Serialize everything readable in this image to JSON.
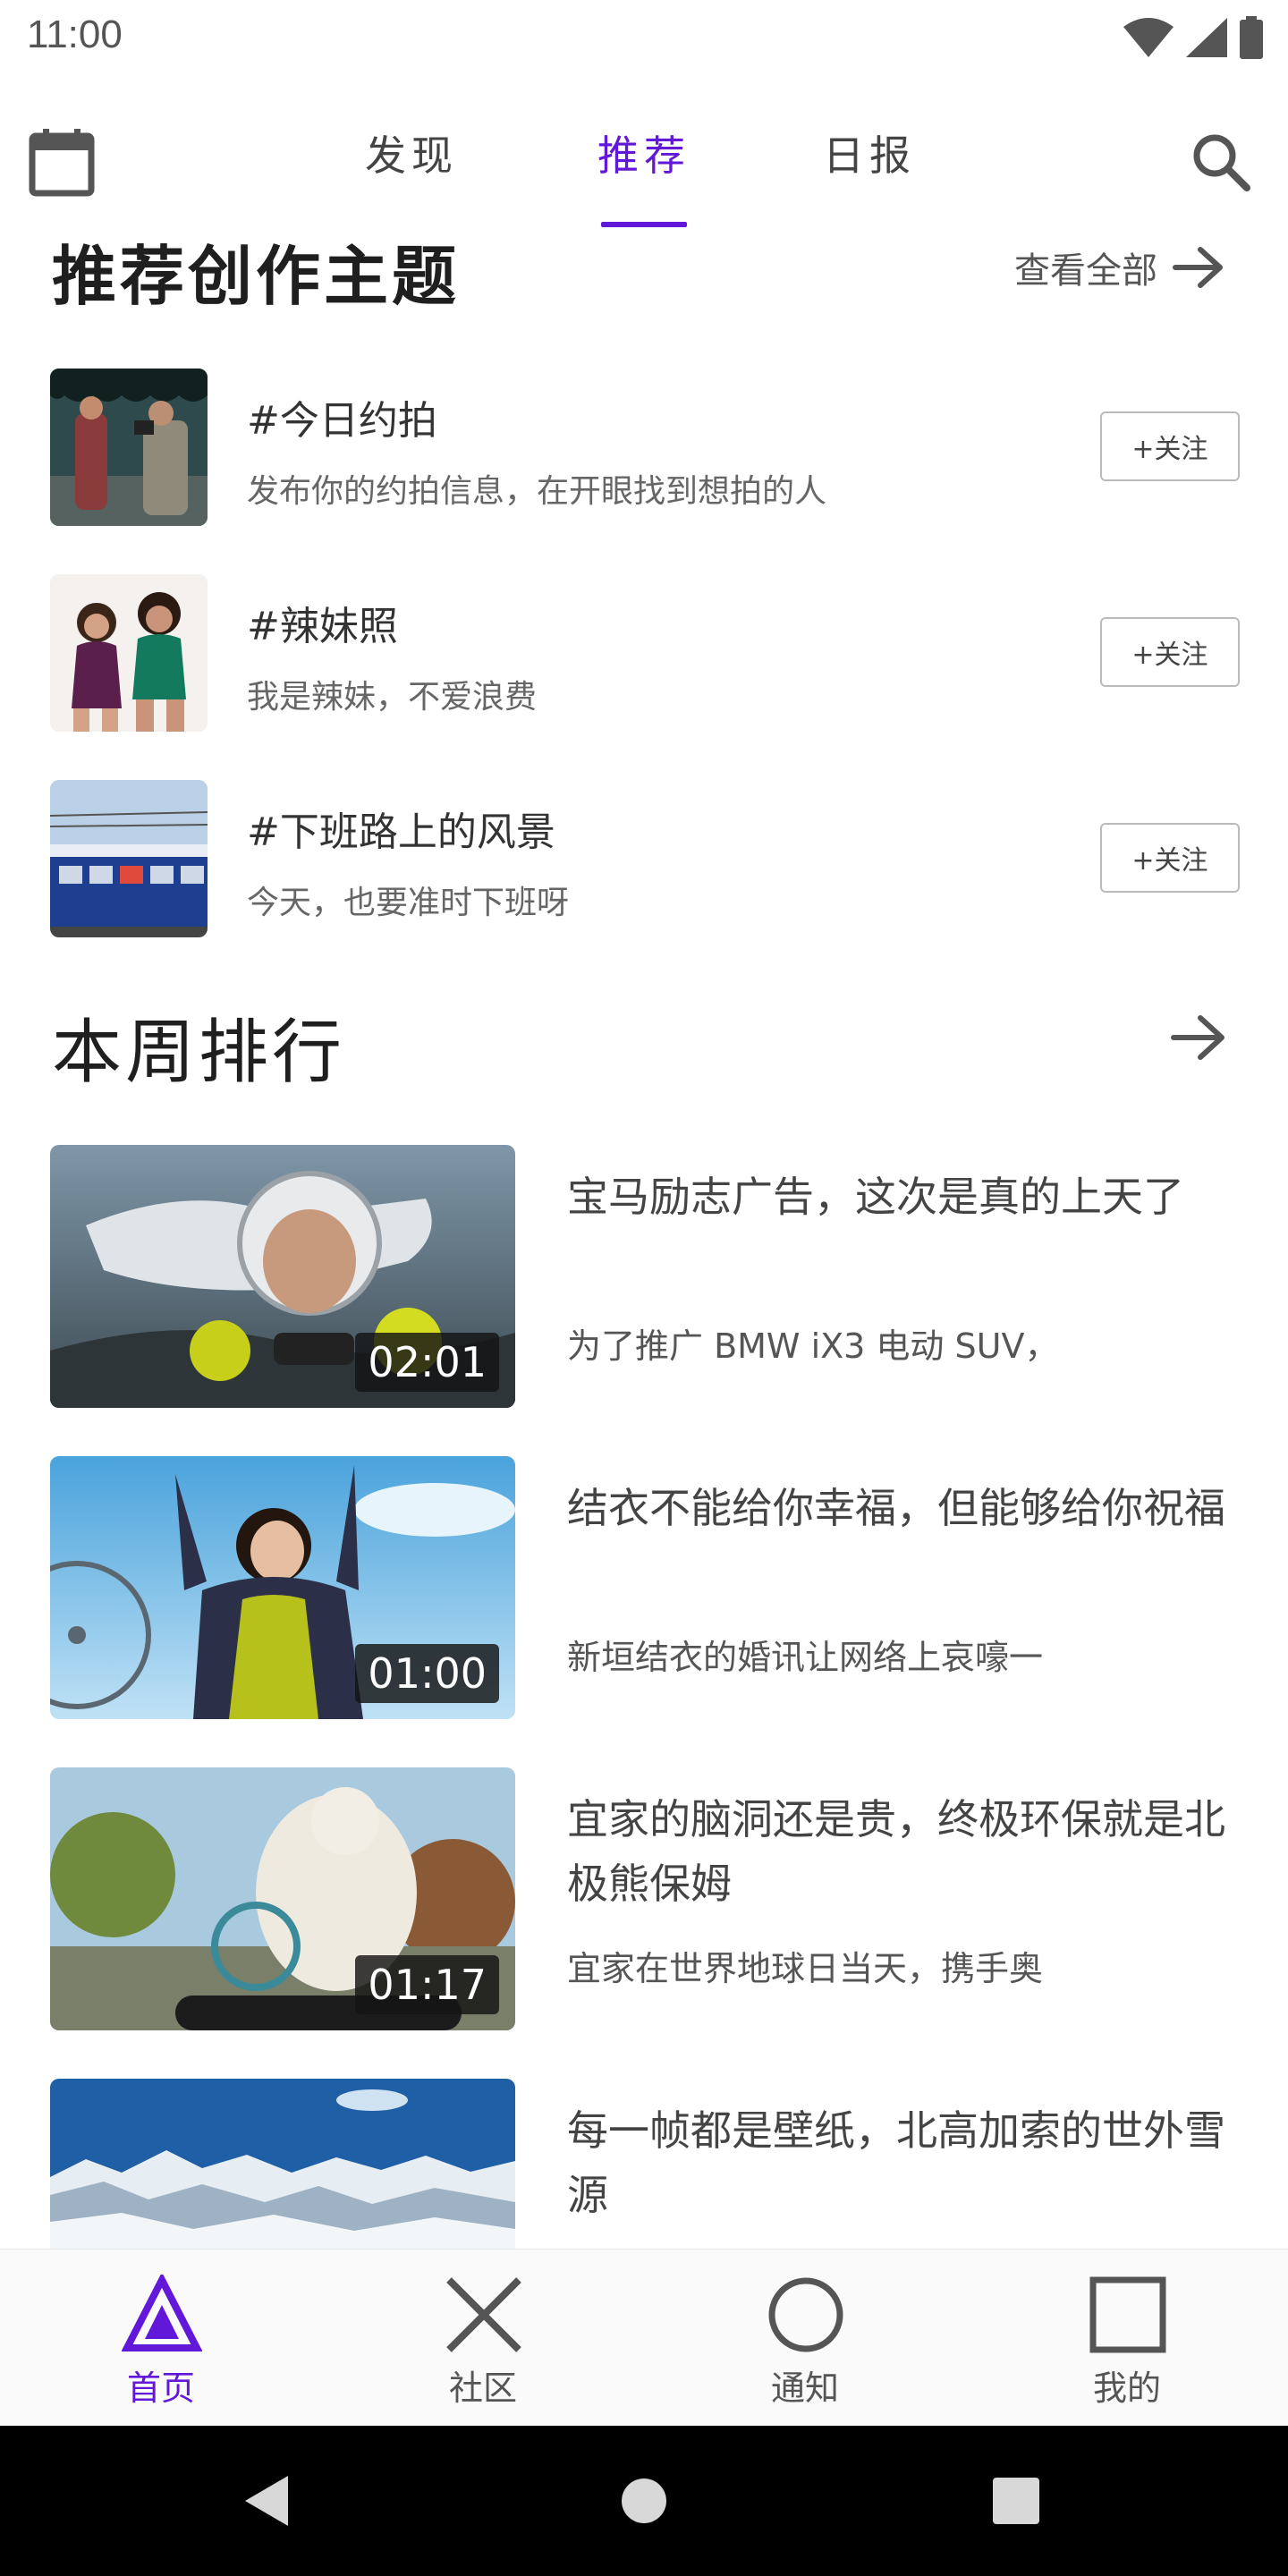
{
  "status_bar": {
    "time": "11:00"
  },
  "tabs": [
    {
      "label": "发现"
    },
    {
      "label": "推荐"
    },
    {
      "label": "日报"
    }
  ],
  "topics_section": {
    "title": "推荐创作主题",
    "see_all": "查看全部",
    "items": [
      {
        "title": "#今日约拍",
        "desc": "发布你的约拍信息，在开眼找到想拍的人",
        "follow": "+关注"
      },
      {
        "title": "#辣妹照",
        "desc": "我是辣妹，不爱浪费",
        "follow": "+关注"
      },
      {
        "title": "#下班路上的风景",
        "desc": "今天，也要准时下班呀",
        "follow": "+关注"
      }
    ]
  },
  "ranking_section": {
    "title": "本周排行",
    "items": [
      {
        "title": "宝马励志广告，这次是真的上天了",
        "desc": "为了推广 BMW iX3 电动 SUV，",
        "duration": "02:01"
      },
      {
        "title": "结衣不能给你幸福，但能够给你祝福",
        "desc": "新垣结衣的婚讯让网络上哀嚎一",
        "duration": "01:00"
      },
      {
        "title": "宜家的脑洞还是贵，终极环保就是北极熊保姆",
        "desc": "宜家在世界地球日当天，携手奥",
        "duration": "01:17"
      },
      {
        "title": "每一帧都是壁纸，北高加索的世外雪源",
        "desc": "",
        "duration": ""
      }
    ]
  },
  "bottom_nav": [
    {
      "label": "首页"
    },
    {
      "label": "社区"
    },
    {
      "label": "通知"
    },
    {
      "label": "我的"
    }
  ],
  "colors": {
    "accent": "#6218d9",
    "text": "#444444"
  }
}
